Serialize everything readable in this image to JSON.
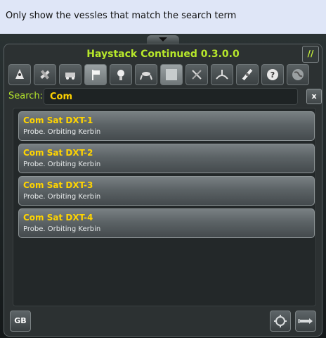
{
  "caption": "Only show the vessles that match the search term",
  "window": {
    "title": "Haystack Continued 0.3.0.0",
    "resize_icon": "//"
  },
  "toolbar": {
    "buttons": [
      {
        "icon": "lander-icon",
        "active": false
      },
      {
        "icon": "satellite-icon",
        "active": false
      },
      {
        "icon": "rover-icon",
        "active": false
      },
      {
        "icon": "flag-icon",
        "active": true
      },
      {
        "icon": "probe-icon",
        "active": false
      },
      {
        "icon": "base-icon",
        "active": false
      },
      {
        "icon": "blank-icon",
        "active": true
      },
      {
        "icon": "debris-icon",
        "active": false
      },
      {
        "icon": "station-icon",
        "active": false
      },
      {
        "icon": "ship-icon",
        "active": false
      },
      {
        "icon": "help-icon",
        "active": false
      },
      {
        "icon": "globe-icon",
        "active": false
      }
    ]
  },
  "search": {
    "label": "Search:",
    "value": "Com",
    "clear_label": "x"
  },
  "vessels": [
    {
      "name": "Com Sat DXT-1",
      "desc": "Probe. Orbiting Kerbin"
    },
    {
      "name": "Com Sat DXT-2",
      "desc": "Probe. Orbiting Kerbin"
    },
    {
      "name": "Com Sat DXT-3",
      "desc": "Probe. Orbiting Kerbin"
    },
    {
      "name": "Com Sat DXT-4",
      "desc": "Probe. Orbiting Kerbin"
    }
  ],
  "footer": {
    "gb_label": "GB",
    "focus_icon": "target-icon",
    "ship_icon": "vessel-icon"
  },
  "colors": {
    "title": "#b7e82b",
    "vessel_name": "#ffd400",
    "search_value": "#ffd200"
  }
}
